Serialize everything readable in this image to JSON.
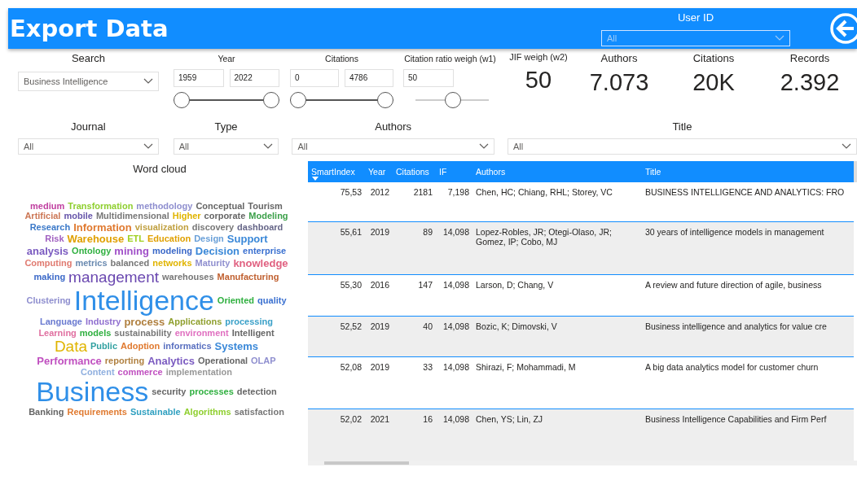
{
  "header": {
    "title": "Export Data",
    "user_id": {
      "label": "User ID",
      "value": "All"
    }
  },
  "filters": [
    {
      "kind": "dropdown",
      "label": "Search",
      "value": "Business Intelligence"
    },
    {
      "kind": "range",
      "label": "Year",
      "low": "1959",
      "high": "2022",
      "thumbs": [
        {
          "level": 0
        },
        {
          "level": 1
        }
      ]
    },
    {
      "kind": "range",
      "label": "Citations",
      "low": "0",
      "high": "4786",
      "thumbs": [
        {
          "level": 0
        },
        {
          "level": 1
        }
      ]
    },
    {
      "kind": "slider",
      "label": "Citation ratio weigh (w1)",
      "value": "50",
      "level": 0.52
    }
  ],
  "cards": [
    {
      "label": "JIF weigh (w2)",
      "value": "50"
    },
    {
      "label": "Authors",
      "value": "7.073"
    },
    {
      "label": "Citations",
      "value": "20K"
    },
    {
      "label": "Records",
      "value": "2.392"
    }
  ],
  "dropdowns": [
    {
      "label": "Journal",
      "value": "All"
    },
    {
      "label": "Type",
      "value": "All"
    },
    {
      "label": "Authors",
      "value": "All"
    },
    {
      "label": "Title",
      "value": "All"
    }
  ],
  "word_cloud": {
    "title": "Word cloud",
    "words": [
      {
        "text": "medium",
        "kind": "s",
        "color": "#c03fa0"
      },
      {
        "text": "Transformation",
        "kind": "s",
        "color": "#8fcf2f"
      },
      {
        "text": "methodology",
        "kind": "s",
        "color": "#8f8fcf"
      },
      {
        "text": "Conceptual",
        "kind": "s",
        "color": "#666666"
      },
      {
        "text": "Tourism",
        "kind": "s",
        "color": "#666666"
      },
      {
        "text": "Artificial",
        "kind": "s",
        "color": "#cc7755"
      },
      {
        "text": "mobile",
        "kind": "s",
        "color": "#6655aa"
      },
      {
        "text": "Multidimensional",
        "kind": "s",
        "color": "#777777"
      },
      {
        "text": "Higher",
        "kind": "s",
        "color": "#e0b400"
      },
      {
        "text": "corporate",
        "kind": "s",
        "color": "#666666"
      },
      {
        "text": "Modeling",
        "kind": "s",
        "color": "#3ca04a"
      },
      {
        "text": "Research",
        "kind": "s",
        "color": "#3a78c8"
      },
      {
        "text": "Information",
        "kind": "m",
        "color": "#e07a30"
      },
      {
        "text": "visualization",
        "kind": "s",
        "color": "#c0a040"
      },
      {
        "text": "discovery",
        "kind": "s",
        "color": "#777777"
      },
      {
        "text": "dashboard",
        "kind": "s",
        "color": "#666688"
      },
      {
        "text": "Risk",
        "kind": "s",
        "color": "#a060c0"
      },
      {
        "text": "Warehouse",
        "kind": "m",
        "color": "#e0a000"
      },
      {
        "text": "ETL",
        "kind": "s",
        "color": "#a0d020"
      },
      {
        "text": "Education",
        "kind": "s",
        "color": "#e0a000"
      },
      {
        "text": "Design",
        "kind": "s",
        "color": "#6aa0d8"
      },
      {
        "text": "Support",
        "kind": "m",
        "color": "#3a88d8"
      },
      {
        "text": "analysis",
        "kind": "m",
        "color": "#7a5ac0"
      },
      {
        "text": "Ontology",
        "kind": "s",
        "color": "#30b040"
      },
      {
        "text": "mining",
        "kind": "m",
        "color": "#a050c8"
      },
      {
        "text": "modeling",
        "kind": "s",
        "color": "#3a68c8"
      },
      {
        "text": "Decision",
        "kind": "m",
        "color": "#3a88d8"
      },
      {
        "text": "enterprise",
        "kind": "s",
        "color": "#3a70d0"
      },
      {
        "text": "Computing",
        "kind": "s",
        "color": "#e07a70"
      },
      {
        "text": "metrics",
        "kind": "s",
        "color": "#6a8ab0"
      },
      {
        "text": "balanced",
        "kind": "s",
        "color": "#777777"
      },
      {
        "text": "networks",
        "kind": "s",
        "color": "#e0b400"
      },
      {
        "text": "Maturity",
        "kind": "s",
        "color": "#8f8fcf"
      },
      {
        "text": "knowledge",
        "kind": "m",
        "color": "#e06080"
      },
      {
        "text": "making",
        "kind": "s",
        "color": "#3a68c8"
      },
      {
        "text": "management",
        "kind": "l",
        "color": "#6a48b0"
      },
      {
        "text": "warehouses",
        "kind": "s",
        "color": "#777777"
      },
      {
        "text": "Manufacturing",
        "kind": "s",
        "color": "#c06030"
      },
      {
        "text": "Clustering",
        "kind": "s",
        "color": "#8f8fcf"
      },
      {
        "text": "Intelligence",
        "kind": "xl",
        "color": "#2f8fe8"
      },
      {
        "text": "Oriented",
        "kind": "s",
        "color": "#30b040"
      },
      {
        "text": "quality",
        "kind": "s",
        "color": "#3a70d0"
      },
      {
        "text": "Language",
        "kind": "s",
        "color": "#6a7ad0"
      },
      {
        "text": "Industry",
        "kind": "s",
        "color": "#8f6fcf"
      },
      {
        "text": "process",
        "kind": "m",
        "color": "#b08040"
      },
      {
        "text": "Applications",
        "kind": "s",
        "color": "#90a030"
      },
      {
        "text": "processing",
        "kind": "s",
        "color": "#3aa0c8"
      },
      {
        "text": "Learning",
        "kind": "s",
        "color": "#e070a0"
      },
      {
        "text": "models",
        "kind": "s",
        "color": "#30b040"
      },
      {
        "text": "sustainability",
        "kind": "s",
        "color": "#777777"
      },
      {
        "text": "environment",
        "kind": "s",
        "color": "#e070c0"
      },
      {
        "text": "Intelligent",
        "kind": "s",
        "color": "#666666"
      },
      {
        "text": "Data",
        "kind": "l",
        "color": "#e0b400"
      },
      {
        "text": "Public",
        "kind": "s",
        "color": "#30a0a0"
      },
      {
        "text": "Adoption",
        "kind": "s",
        "color": "#e07a30"
      },
      {
        "text": "informatics",
        "kind": "s",
        "color": "#5a70c0"
      },
      {
        "text": "Systems",
        "kind": "m",
        "color": "#3a88d8"
      },
      {
        "text": "Performance",
        "kind": "m",
        "color": "#c050c0"
      },
      {
        "text": "reporting",
        "kind": "s",
        "color": "#b08040"
      },
      {
        "text": "Analytics",
        "kind": "m",
        "color": "#7a5ac0"
      },
      {
        "text": "Operational",
        "kind": "s",
        "color": "#666666"
      },
      {
        "text": "OLAP",
        "kind": "s",
        "color": "#8f8fcf"
      },
      {
        "text": "Content",
        "kind": "s",
        "color": "#8fafdf"
      },
      {
        "text": "commerce",
        "kind": "s",
        "color": "#c050c0"
      },
      {
        "text": "implementation",
        "kind": "s",
        "color": "#999999"
      },
      {
        "text": "Business",
        "kind": "xl",
        "color": "#2f8fe8"
      },
      {
        "text": "security",
        "kind": "s",
        "color": "#666666"
      },
      {
        "text": "processes",
        "kind": "s",
        "color": "#30b040"
      },
      {
        "text": "detection",
        "kind": "s",
        "color": "#666666"
      },
      {
        "text": "Banking",
        "kind": "s",
        "color": "#666666"
      },
      {
        "text": "Requirements",
        "kind": "s",
        "color": "#e07a30"
      },
      {
        "text": "Sustainable",
        "kind": "s",
        "color": "#30a0c0"
      },
      {
        "text": "Algorithms",
        "kind": "s",
        "color": "#8fcf2f"
      },
      {
        "text": "satisfaction",
        "kind": "s",
        "color": "#777777"
      }
    ]
  },
  "table": {
    "columns": [
      {
        "label": "SmartIndex",
        "sorted": true
      },
      {
        "label": "Year",
        "sorted": false
      },
      {
        "label": "Citations",
        "sorted": false
      },
      {
        "label": "IF",
        "sorted": false
      },
      {
        "label": "Authors",
        "sorted": false
      },
      {
        "label": "Title",
        "sorted": false
      }
    ],
    "rows": [
      [
        "75,53",
        "2012",
        "2181",
        "7,198",
        "Chen, HC; Chiang, RHL; Storey, VC",
        "BUSINESS INTELLIGENCE AND ANALYTICS: FRO"
      ],
      [
        "55,61",
        "2019",
        "89",
        "14,098",
        "Lopez-Robles, JR; Otegi-Olaso, JR; Gomez, IP; Cobo, MJ",
        "30 years of intelligence models in management"
      ],
      [
        "55,30",
        "2016",
        "147",
        "14,098",
        "Larson, D; Chang, V",
        "A review and future direction of agile, business"
      ],
      [
        "52,52",
        "2019",
        "40",
        "14,098",
        "Bozic, K; Dimovski, V",
        "Business intelligence and analytics for value cre"
      ],
      [
        "52,08",
        "2019",
        "33",
        "14,098",
        "Shirazi, F; Mohammadi, M",
        "A big data analytics model for customer churn"
      ],
      [
        "52,02",
        "2021",
        "16",
        "14,098",
        "Chen, YS; Lin, ZJ",
        "Business Intelligence Capabilities and Firm Perf"
      ]
    ]
  }
}
